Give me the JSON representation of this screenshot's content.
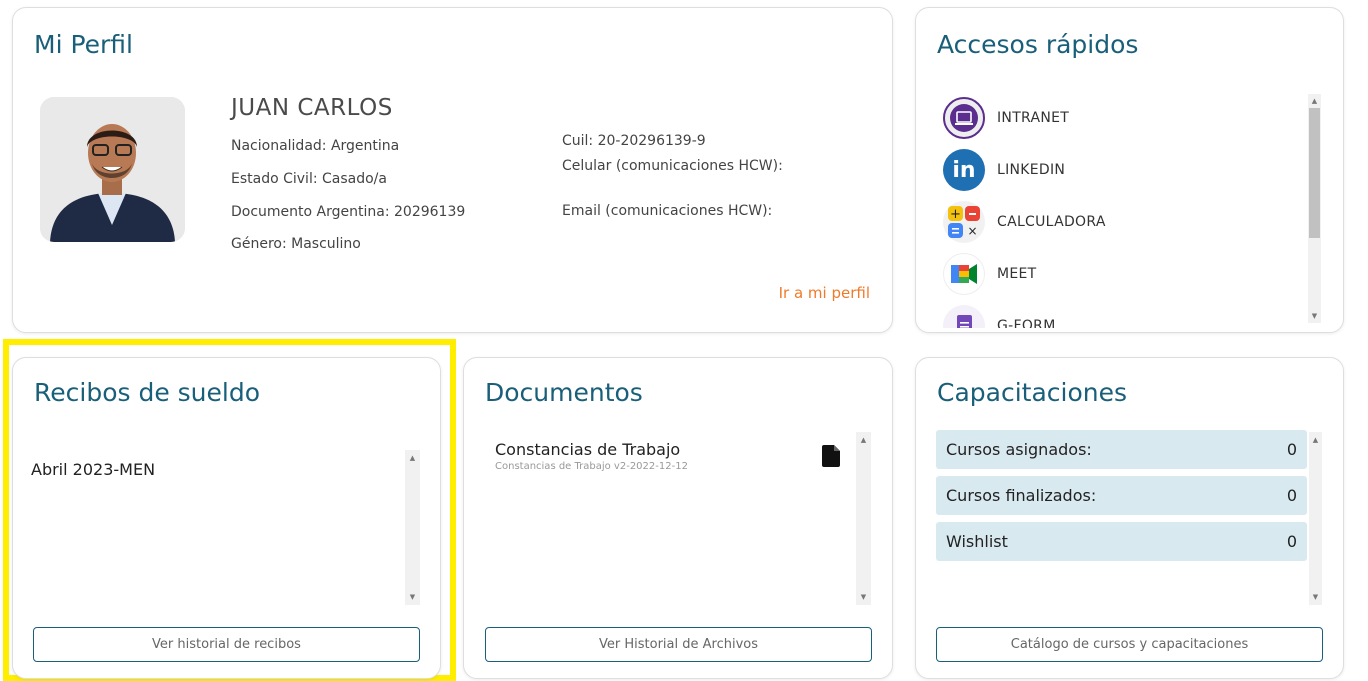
{
  "perfil": {
    "title": "Mi Perfil",
    "name": "JUAN CARLOS",
    "nacionalidad": "Nacionalidad: Argentina",
    "estado_civil": "Estado Civil: Casado/a",
    "documento": "Documento Argentina: 20296139",
    "genero": "Género: Masculino",
    "cuil": "Cuil: 20-20296139-9",
    "celular": "Celular (comunicaciones HCW):",
    "email": "Email (comunicaciones HCW):",
    "link": "Ir a mi perfil",
    "avatar_icon": "person-photo"
  },
  "accesos": {
    "title": "Accesos rápidos",
    "items": [
      {
        "label": "INTRANET",
        "icon": "intranet-icon",
        "color": "#5b2d8e"
      },
      {
        "label": "LINKEDIN",
        "icon": "linkedin-icon",
        "color": "#1f6fb3"
      },
      {
        "label": "CALCULADORA",
        "icon": "calculator-icon",
        "color": "#e9e9e9"
      },
      {
        "label": "MEET",
        "icon": "meet-icon",
        "color": "#ffffff"
      },
      {
        "label": "G-FORM",
        "icon": "gform-icon",
        "color": "#7248b9"
      }
    ]
  },
  "recibos": {
    "title": "Recibos de sueldo",
    "items": [
      "Abril 2023-MEN"
    ],
    "button": "Ver historial de recibos"
  },
  "documentos": {
    "title": "Documentos",
    "items": [
      {
        "title": "Constancias de Trabajo",
        "subtitle": "Constancias de Trabajo v2-2022-12-12"
      }
    ],
    "button": "Ver Historial de Archivos"
  },
  "capacitaciones": {
    "title": "Capacitaciones",
    "rows": [
      {
        "label": "Cursos asignados:",
        "value": "0"
      },
      {
        "label": "Cursos finalizados:",
        "value": "0"
      },
      {
        "label": "Wishlist",
        "value": "0"
      }
    ],
    "button": "Catálogo de cursos y capacitaciones"
  },
  "colors": {
    "title": "#1a5f7a",
    "link": "#f07a2b",
    "highlight": "#ffee00",
    "row_bg": "#d9e9f0"
  }
}
